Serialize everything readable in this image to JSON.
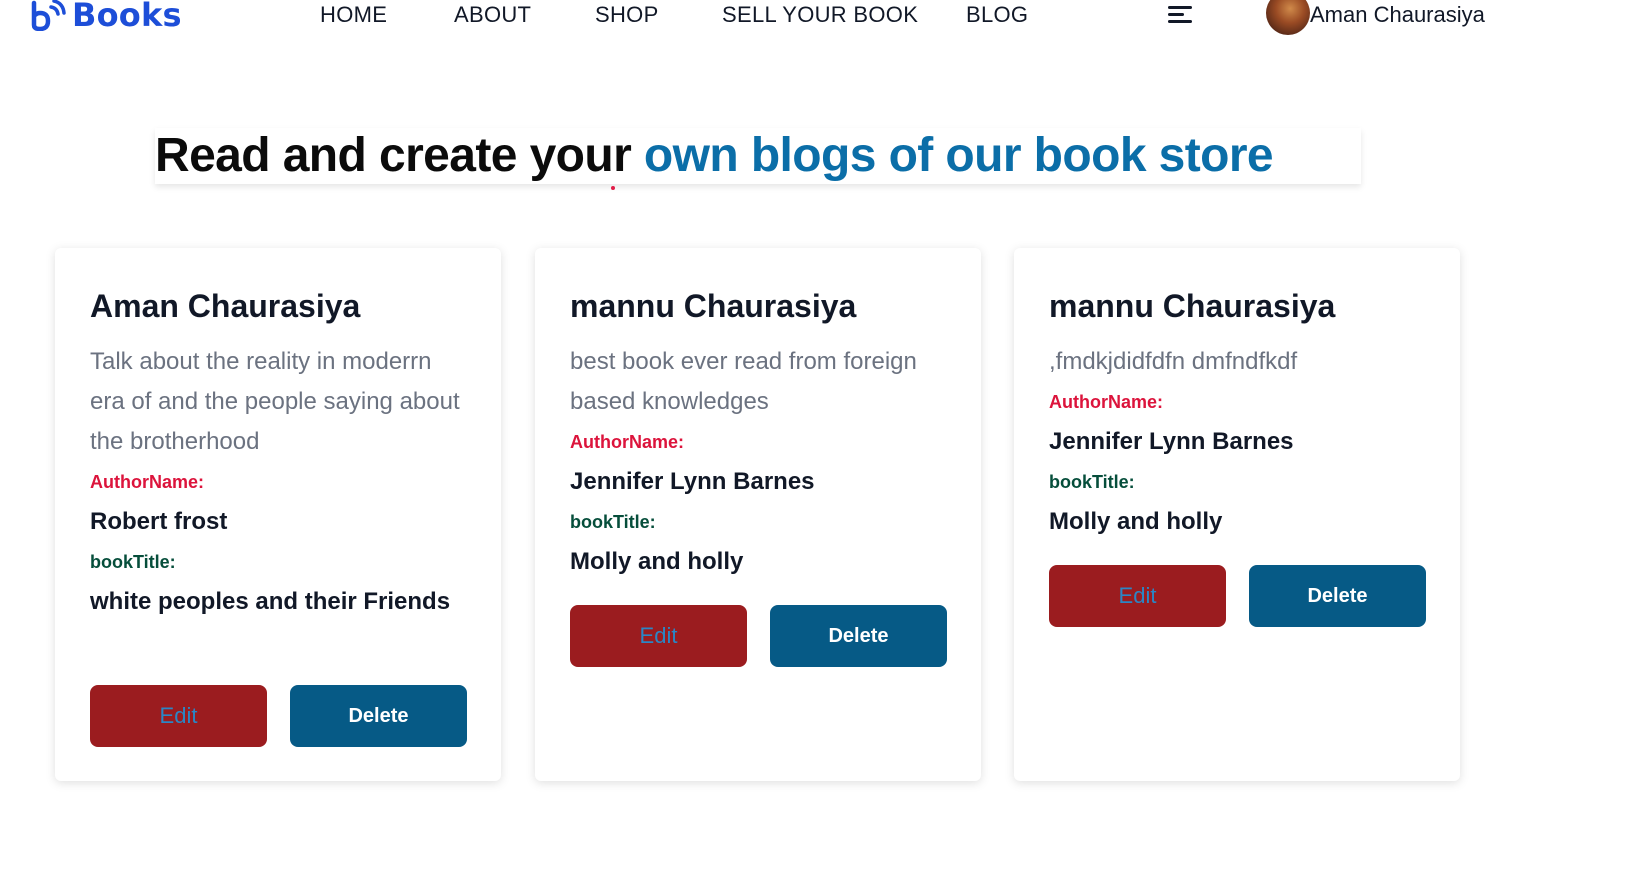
{
  "navbar": {
    "logo_text": "Books",
    "links": [
      "HOME",
      "ABOUT",
      "SHOP",
      "SELL YOUR BOOK",
      "BLOG"
    ],
    "user_name": "Aman Chaurasiya",
    "icons": {
      "logo": "books-logo-icon",
      "menu": "hamburger-menu-icon"
    }
  },
  "hero": {
    "heading_black": "Read and create your ",
    "heading_blue": "own blogs of our book store"
  },
  "labels": {
    "author_label": "AuthorName:",
    "book_label": "bookTitle:",
    "edit": "Edit",
    "delete": "Delete"
  },
  "posts": [
    {
      "user": "Aman Chaurasiya",
      "description": "Talk about the reality in moderrn era of and the people saying about the brotherhood",
      "author": "Robert frost",
      "book_title": "white peoples and their Friends"
    },
    {
      "user": "mannu Chaurasiya",
      "description": "best book ever read from foreign based knowledges",
      "author": "Jennifer Lynn Barnes",
      "book_title": "Molly and holly"
    },
    {
      "user": "mannu Chaurasiya",
      "description": ",fmdkjdidfdfn dmfndfkdf",
      "author": "Jennifer Lynn Barnes",
      "book_title": "Molly and holly"
    }
  ],
  "colors": {
    "brand_blue": "#1d4ed8",
    "heading_blue": "#0b6ea8",
    "author_label": "#dc143c",
    "book_label": "#064e3b",
    "edit_button": "#9b1c1f",
    "delete_button": "#065a86"
  }
}
